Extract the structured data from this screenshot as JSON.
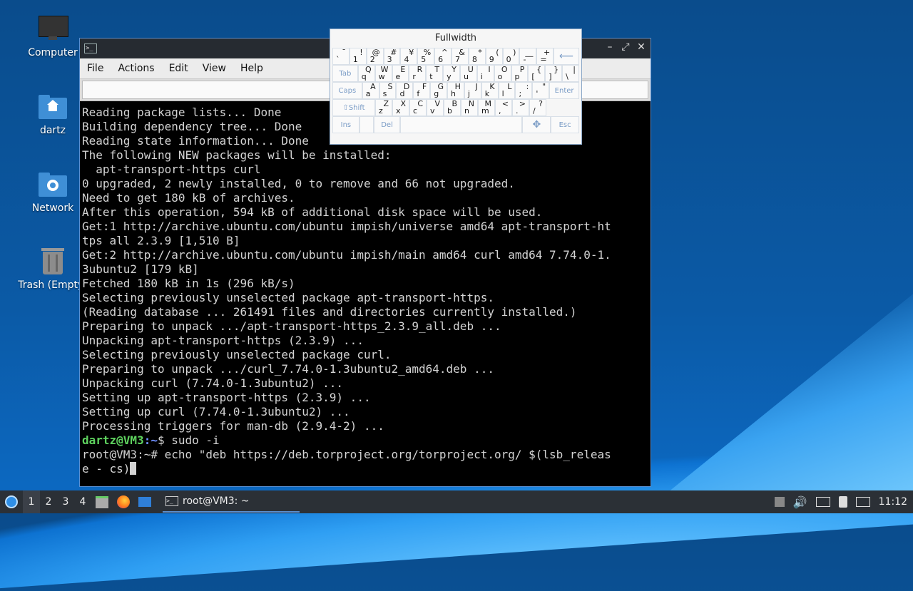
{
  "desktop": {
    "icons": [
      {
        "label": "Computer"
      },
      {
        "label": "dartz"
      },
      {
        "label": "Network"
      },
      {
        "label": "Trash (Empty)"
      }
    ]
  },
  "terminal": {
    "menu": [
      "File",
      "Actions",
      "Edit",
      "View",
      "Help"
    ],
    "tab_title": "root@VM3: ~",
    "lines": [
      "Reading package lists... Done",
      "Building dependency tree... Done",
      "Reading state information... Done",
      "The following NEW packages will be installed:",
      "  apt-transport-https curl",
      "0 upgraded, 2 newly installed, 0 to remove and 66 not upgraded.",
      "Need to get 180 kB of archives.",
      "After this operation, 594 kB of additional disk space will be used.",
      "Get:1 http://archive.ubuntu.com/ubuntu impish/universe amd64 apt-transport-ht",
      "tps all 2.3.9 [1,510 B]",
      "Get:2 http://archive.ubuntu.com/ubuntu impish/main amd64 curl amd64 7.74.0-1.",
      "3ubuntu2 [179 kB]",
      "Fetched 180 kB in 1s (296 kB/s)",
      "Selecting previously unselected package apt-transport-https.",
      "(Reading database ... 261491 files and directories currently installed.)",
      "Preparing to unpack .../apt-transport-https_2.3.9_all.deb ...",
      "Unpacking apt-transport-https (2.3.9) ...",
      "Selecting previously unselected package curl.",
      "Preparing to unpack .../curl_7.74.0-1.3ubuntu2_amd64.deb ...",
      "Unpacking curl (7.74.0-1.3ubuntu2) ...",
      "Setting up apt-transport-https (2.3.9) ...",
      "Setting up curl (7.74.0-1.3ubuntu2) ...",
      "Processing triggers for man-db (2.9.4-2) ..."
    ],
    "prompt_user": "dartz@VM3",
    "prompt_path": ":~",
    "prompt_sym": "$",
    "prompt_cmd": " sudo -i",
    "root_line1": "root@VM3:~# echo \"deb https://deb.torproject.org/torproject.org/ $(lsb_releas",
    "root_line2": "e - cs)"
  },
  "keyboard": {
    "title": "Fullwidth",
    "row1": [
      {
        "u": "¯",
        "l": "`"
      },
      {
        "u": "!",
        "l": "1"
      },
      {
        "u": "@",
        "l": "2"
      },
      {
        "u": "#",
        "l": "3"
      },
      {
        "u": "¥",
        "l": "4"
      },
      {
        "u": "%",
        "l": "5"
      },
      {
        "u": "^",
        "l": "6"
      },
      {
        "u": "&",
        "l": "7"
      },
      {
        "u": "*",
        "l": "8"
      },
      {
        "u": "(",
        "l": "9"
      },
      {
        "u": ")",
        "l": "0"
      },
      {
        "u": "__",
        "l": "-"
      },
      {
        "u": "+",
        "l": "="
      }
    ],
    "row2": [
      {
        "u": "Q",
        "l": "q"
      },
      {
        "u": "W",
        "l": "w"
      },
      {
        "u": "E",
        "l": "e"
      },
      {
        "u": "R",
        "l": "r"
      },
      {
        "u": "T",
        "l": "t"
      },
      {
        "u": "Y",
        "l": "y"
      },
      {
        "u": "U",
        "l": "u"
      },
      {
        "u": "I",
        "l": "i"
      },
      {
        "u": "O",
        "l": "o"
      },
      {
        "u": "P",
        "l": "p"
      },
      {
        "u": "{",
        "l": "["
      },
      {
        "u": "}",
        "l": "]"
      },
      {
        "u": "|",
        "l": "\\"
      }
    ],
    "row3": [
      {
        "u": "A",
        "l": "a"
      },
      {
        "u": "S",
        "l": "s"
      },
      {
        "u": "D",
        "l": "d"
      },
      {
        "u": "F",
        "l": "f"
      },
      {
        "u": "G",
        "l": "g"
      },
      {
        "u": "H",
        "l": "h"
      },
      {
        "u": "J",
        "l": "j"
      },
      {
        "u": "K",
        "l": "k"
      },
      {
        "u": "L",
        "l": "l"
      },
      {
        "u": ":",
        "l": ";"
      },
      {
        "u": "\"",
        "l": "'"
      }
    ],
    "row4": [
      {
        "u": "Z",
        "l": "z"
      },
      {
        "u": "X",
        "l": "x"
      },
      {
        "u": "C",
        "l": "c"
      },
      {
        "u": "V",
        "l": "v"
      },
      {
        "u": "B",
        "l": "b"
      },
      {
        "u": "N",
        "l": "n"
      },
      {
        "u": "M",
        "l": "m"
      },
      {
        "u": "<",
        "l": ","
      },
      {
        "u": ">",
        "l": "."
      },
      {
        "u": "?",
        "l": "/"
      }
    ],
    "keys": {
      "tab": "Tab",
      "caps": "Caps",
      "enter": "Enter",
      "shift": "Shift",
      "ins": "Ins",
      "del": "Del",
      "esc": "Esc"
    }
  },
  "taskbar": {
    "workspaces": [
      "1",
      "2",
      "3",
      "4"
    ],
    "task_title": "root@VM3: ~",
    "clock": "11:12"
  }
}
